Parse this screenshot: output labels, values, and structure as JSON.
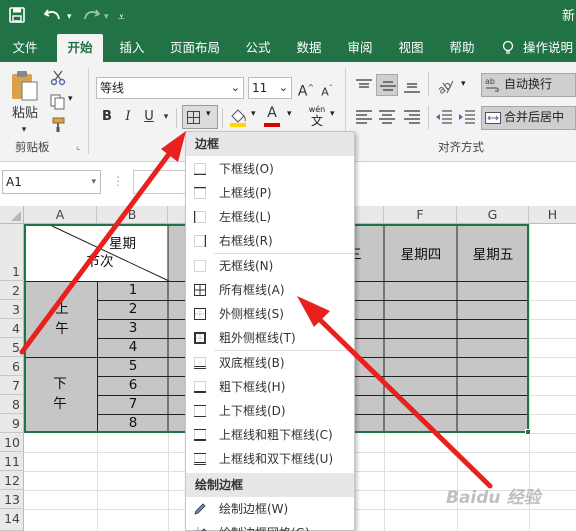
{
  "title_right": "新",
  "tabs": [
    "文件",
    "开始",
    "插入",
    "页面布局",
    "公式",
    "数据",
    "审阅",
    "视图",
    "帮助",
    "操作说明"
  ],
  "ribbon": {
    "paste": "粘贴",
    "clipboard_label": "剪贴板",
    "font_name": "等线",
    "font_size": "11",
    "bold": "B",
    "italic": "I",
    "underline": "U",
    "font_grow": "A",
    "font_shrink": "A",
    "font_color_letter": "A",
    "wen_glyph": "wén",
    "wen_char": "文",
    "wrap_text": "自动换行",
    "merge_center": "合并后居中",
    "alignment_label": "对齐方式"
  },
  "formula_bar": {
    "cell_ref": "A1"
  },
  "sheet": {
    "columns": [
      "A",
      "B",
      "C",
      "D",
      "E",
      "F",
      "G",
      "H"
    ],
    "rows": [
      "1",
      "2",
      "3",
      "4",
      "5",
      "6",
      "7",
      "8",
      "9",
      "10",
      "11",
      "12",
      "13",
      "14"
    ],
    "header_top": "星期",
    "header_bottom": "节次",
    "weekday_e": "三",
    "weekday_f": "星期四",
    "weekday_g": "星期五",
    "morning": [
      "上",
      "午"
    ],
    "afternoon": [
      "下",
      "午"
    ],
    "periods": [
      "1",
      "2",
      "3",
      "4",
      "5",
      "6",
      "7",
      "8"
    ]
  },
  "border_menu": {
    "header": "边框",
    "items": [
      "下框线(O)",
      "上框线(P)",
      "左框线(L)",
      "右框线(R)",
      "无框线(N)",
      "所有框线(A)",
      "外侧框线(S)",
      "粗外侧框线(T)",
      "双底框线(B)",
      "粗下框线(H)",
      "上下框线(D)",
      "上框线和粗下框线(C)",
      "上框线和双下框线(U)"
    ],
    "draw_header": "绘制边框",
    "draw_items": [
      "绘制边框(W)",
      "绘制边框网格(G)"
    ]
  },
  "watermark": "Baidu 经验"
}
